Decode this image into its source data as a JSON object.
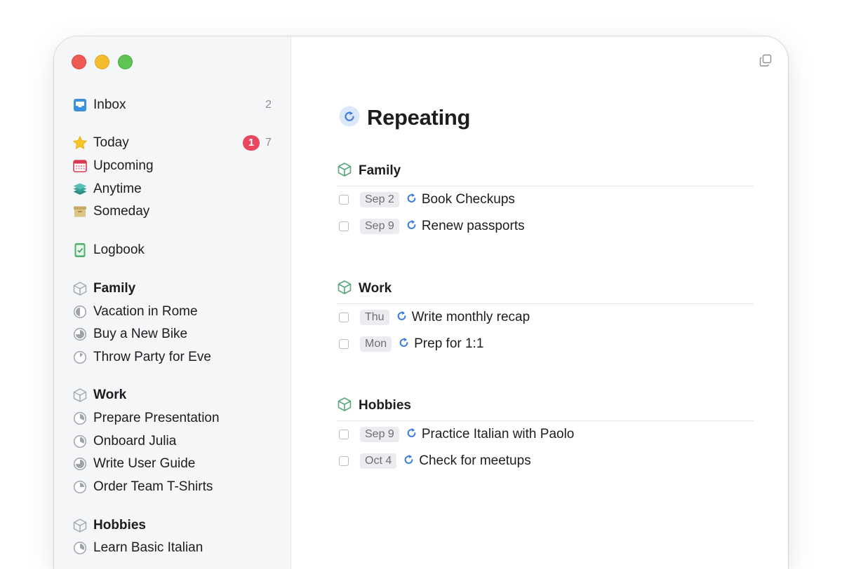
{
  "sidebar": {
    "inbox": {
      "label": "Inbox",
      "count": "2"
    },
    "today": {
      "label": "Today",
      "badge": "1",
      "count": "7"
    },
    "upcoming": {
      "label": "Upcoming"
    },
    "anytime": {
      "label": "Anytime"
    },
    "someday": {
      "label": "Someday"
    },
    "logbook": {
      "label": "Logbook"
    },
    "areas": [
      {
        "label": "Family",
        "projects": [
          "Vacation in Rome",
          "Buy a New Bike",
          "Throw Party for Eve"
        ]
      },
      {
        "label": "Work",
        "projects": [
          "Prepare Presentation",
          "Onboard Julia",
          "Write User Guide",
          "Order Team T-Shirts"
        ]
      },
      {
        "label": "Hobbies",
        "projects": [
          "Learn Basic Italian"
        ]
      }
    ]
  },
  "main": {
    "title": "Repeating",
    "sections": [
      {
        "name": "Family",
        "tasks": [
          {
            "date": "Sep 2",
            "title": "Book Checkups"
          },
          {
            "date": "Sep 9",
            "title": "Renew passports"
          }
        ]
      },
      {
        "name": "Work",
        "tasks": [
          {
            "date": "Thu",
            "title": "Write monthly recap"
          },
          {
            "date": "Mon",
            "title": "Prep for 1:1"
          }
        ]
      },
      {
        "name": "Hobbies",
        "tasks": [
          {
            "date": "Sep 9",
            "title": "Practice Italian with Paolo"
          },
          {
            "date": "Oct 4",
            "title": "Check for meetups"
          }
        ]
      }
    ]
  },
  "colors": {
    "accent_blue": "#3f7de0",
    "area_green": "#5aa77c",
    "badge_red": "#e8475f",
    "sidebar_bg": "#f5f6f8"
  },
  "icons": {
    "inbox": "inbox-tray-icon",
    "today": "star-icon",
    "upcoming": "calendar-icon",
    "anytime": "layers-icon",
    "someday": "archive-box-icon",
    "logbook": "logbook-check-icon",
    "area": "cube-icon",
    "project": "progress-pie-icon",
    "repeat": "repeat-icon",
    "window": "copy-window-icon"
  }
}
